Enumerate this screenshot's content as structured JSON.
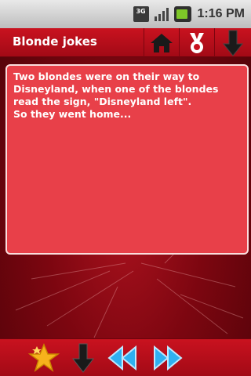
{
  "status_bar": {
    "network_badge": "3G",
    "time": "1:16 PM",
    "icons": [
      "3g-icon",
      "signal-icon",
      "battery-icon"
    ]
  },
  "header": {
    "title": "Blonde jokes",
    "buttons": [
      "home-icon",
      "medal-icon",
      "download-arrow-icon"
    ]
  },
  "joke": {
    "text": "Two blondes were on their way to Disneyland, when one of the blondes read the sign, \"Disneyland left\".\nSo they went home..."
  },
  "bottom_bar": {
    "buttons": [
      "star-icon",
      "down-arrow-icon",
      "rewind-icon",
      "fast-forward-icon"
    ]
  },
  "colors": {
    "header": "#b80e1a",
    "joke_box": "#e84049",
    "background": "#7c0610",
    "nav_arrows": "#2fb0f0"
  }
}
